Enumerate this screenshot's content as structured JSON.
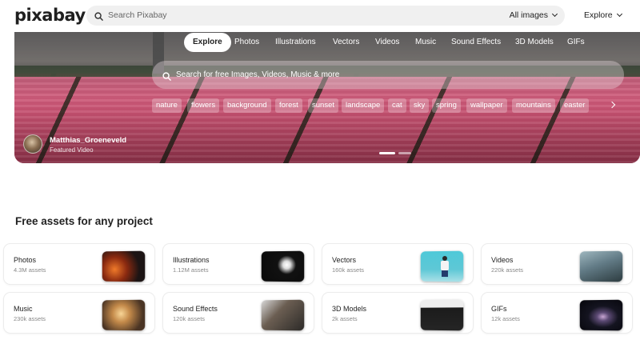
{
  "header": {
    "logo": "pixabay",
    "search_placeholder": "Search Pixabay",
    "filter_label": "All images",
    "explore_label": "Explore"
  },
  "hero": {
    "tabs": [
      "Explore",
      "Photos",
      "Illustrations",
      "Vectors",
      "Videos",
      "Music",
      "Sound Effects",
      "3D Models",
      "GIFs"
    ],
    "active_tab": "Explore",
    "search_placeholder": "Search for free Images, Videos, Music & more",
    "chips": [
      "nature",
      "flowers",
      "background",
      "forest",
      "sunset",
      "landscape",
      "cat",
      "sky",
      "spring",
      "wallpaper",
      "mountains",
      "easter"
    ],
    "author_name": "Matthias_Groeneveld",
    "author_sub": "Featured Video"
  },
  "section": {
    "title": "Free assets for any project",
    "cards": [
      {
        "title": "Photos",
        "count": "4.3M assets",
        "thumb": "photos"
      },
      {
        "title": "Illustrations",
        "count": "1.12M assets",
        "thumb": "illus"
      },
      {
        "title": "Vectors",
        "count": "160k assets",
        "thumb": "vectors"
      },
      {
        "title": "Videos",
        "count": "220k assets",
        "thumb": "videos"
      },
      {
        "title": "Music",
        "count": "230k assets",
        "thumb": "music"
      },
      {
        "title": "Sound Effects",
        "count": "120k assets",
        "thumb": "sound"
      },
      {
        "title": "3D Models",
        "count": "2k assets",
        "thumb": "3d"
      },
      {
        "title": "GIFs",
        "count": "12k assets",
        "thumb": "gifs"
      }
    ]
  },
  "icons": {
    "search": "search-icon",
    "chevron": "chevron-down-icon",
    "next": "chevron-right-icon"
  }
}
